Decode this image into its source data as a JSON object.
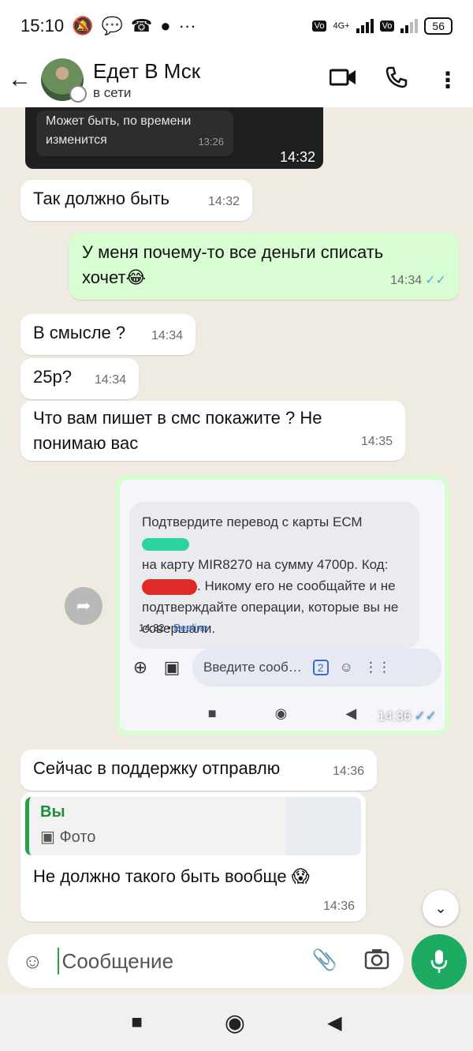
{
  "status_bar": {
    "time": "15:10",
    "network": "4G+",
    "battery": "56"
  },
  "header": {
    "contact_name": "Едет В Мск",
    "status": "в сети"
  },
  "messages": {
    "top_image": {
      "inner_text": "Может быть, по времени изменится",
      "inner_time": "13:26",
      "time": "14:32"
    },
    "m1": {
      "text": "Так должно быть",
      "time": "14:32"
    },
    "m2": {
      "text": "У меня почему-то все деньги списать хочет😂",
      "time": "14:34"
    },
    "m3": {
      "text": "В смысле ?",
      "time": "14:34"
    },
    "m4": {
      "text": "25р?",
      "time": "14:34"
    },
    "m5": {
      "text": "Что вам пишет в смс покажите ? Не понимаю вас",
      "time": "14:35"
    },
    "screenshot": {
      "sms_text_a": "Подтвердите перевод с карты ЕСМ",
      "sms_text_b": "на карту MIR8270 на сумму 4700р. Код:",
      "sms_text_c": ". Никому его не сообщайте и не подтверждайте операции, которые вы не совершали.",
      "sms_meta_time": "14:32",
      "sms_meta_sender": "Beeline",
      "compose_placeholder": "Введите сооб…",
      "compose_badge": "2",
      "time": "14:36"
    },
    "m6": {
      "text": "Сейчас в поддержку отправлю",
      "time": "14:36"
    },
    "m7": {
      "quote_name": "Вы",
      "quote_type": "Фото",
      "text": "Не должно такого быть вообще 😱",
      "time": "14:36"
    }
  },
  "input": {
    "placeholder": "Сообщение"
  },
  "colors": {
    "outgoing": "#d9fdd3",
    "incoming": "#ffffff",
    "accent": "#1daa61",
    "tick": "#4fa8e9"
  }
}
